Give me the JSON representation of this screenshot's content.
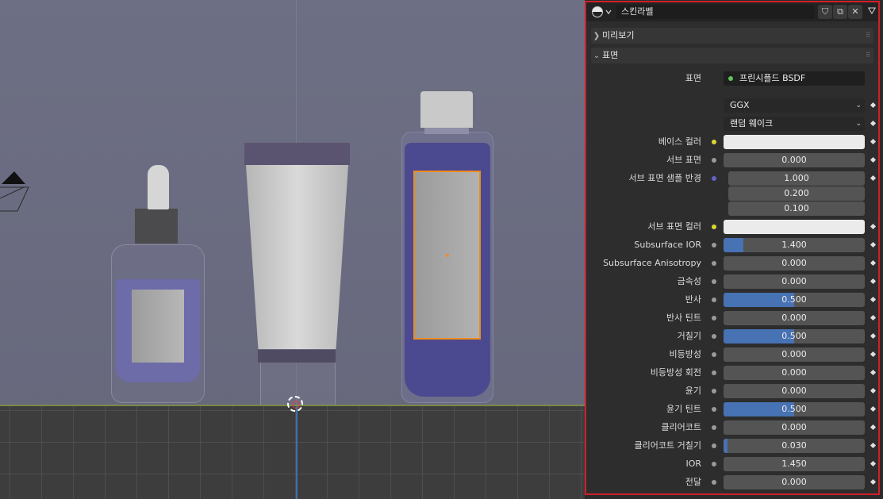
{
  "material": {
    "name": "스킨라벨"
  },
  "sections": {
    "preview": "미리보기",
    "surface": "표면"
  },
  "surface": {
    "label": "표면",
    "shader": "프린시플드 BSDF"
  },
  "distribution": "GGX",
  "subsurface_method": "랜덤 웨이크",
  "base_color": {
    "label": "베이스 컬러",
    "color": "#ebebeb"
  },
  "subsurface": {
    "label": "서브 표면",
    "value": "0.000"
  },
  "subsurface_radius": {
    "label": "서브 표면 샘플 반경",
    "values": [
      "1.000",
      "0.200",
      "0.100"
    ]
  },
  "subsurface_color": {
    "label": "서브 표면 컬러",
    "color": "#ebebeb"
  },
  "params": [
    {
      "label": "Subsurface IOR",
      "value": "1.400",
      "fill": 0.14
    },
    {
      "label": "Subsurface Anisotropy",
      "value": "0.000",
      "fill": 0
    },
    {
      "label": "금속성",
      "value": "0.000",
      "fill": 0
    },
    {
      "label": "반사",
      "value": "0.500",
      "fill": 0.5
    },
    {
      "label": "반사 틴트",
      "value": "0.000",
      "fill": 0
    },
    {
      "label": "거칠기",
      "value": "0.500",
      "fill": 0.5
    },
    {
      "label": "비등방성",
      "value": "0.000",
      "fill": 0
    },
    {
      "label": "비등방성 회전",
      "value": "0.000",
      "fill": 0
    },
    {
      "label": "윤기",
      "value": "0.000",
      "fill": 0
    },
    {
      "label": "윤기 틴트",
      "value": "0.500",
      "fill": 0.5
    },
    {
      "label": "클리어코트",
      "value": "0.000",
      "fill": 0
    },
    {
      "label": "클리어코트 거칠기",
      "value": "0.030",
      "fill": 0.03
    },
    {
      "label": "IOR",
      "value": "1.450",
      "fill": 0
    },
    {
      "label": "전달",
      "value": "0.000",
      "fill": 0
    }
  ],
  "colors": {
    "panel_border": "#d01f2a",
    "slider_fill": "#4772b3",
    "shader_socket": "#5fc35a",
    "color_socket": "#d8d832",
    "vector_socket": "#6363c7",
    "selection_outline": "#f08c1e"
  }
}
